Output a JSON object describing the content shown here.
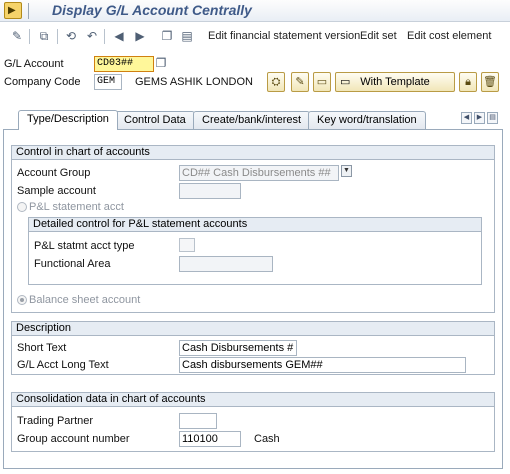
{
  "window": {
    "title": "Display G/L Account Centrally"
  },
  "toolbar": {
    "icons": [
      "display-change-icon",
      "where-used-icon",
      "other-object-icon",
      "undo-icon",
      "previous-icon",
      "next-icon",
      "copy-icon",
      "print-icon"
    ],
    "edit_fs_version": "Edit financial statement version",
    "edit_set": "Edit set",
    "edit_cost_element": "Edit cost element"
  },
  "header": {
    "gl_account_label": "G/L Account",
    "gl_account_value": "CD03##",
    "company_code_label": "Company Code",
    "company_code_value": "GEM",
    "company_name": "GEMS ASHIK LONDON",
    "with_template": "With Template"
  },
  "tabs": [
    {
      "label": "Type/Description",
      "active": true
    },
    {
      "label": "Control Data",
      "active": false
    },
    {
      "label": "Create/bank/interest",
      "active": false
    },
    {
      "label": "Key word/translation",
      "active": false
    }
  ],
  "control_chart": {
    "title": "Control in chart of accounts",
    "account_group_label": "Account Group",
    "account_group_value": "CD## Cash Disbursements ##",
    "sample_account_label": "Sample account",
    "sample_account_value": "",
    "pl_statement_label": "P&L statement acct",
    "pl_statement_selected": false,
    "detailed_title": "Detailed control for P&L statement accounts",
    "pl_type_label": "P&L statmt acct type",
    "functional_area_label": "Functional Area",
    "balance_sheet_label": "Balance sheet account",
    "balance_sheet_selected": true
  },
  "description": {
    "title": "Description",
    "short_text_label": "Short Text",
    "short_text_value": "Cash Disbursements #",
    "long_text_label": "G/L Acct Long Text",
    "long_text_value": "Cash disbursements GEM##"
  },
  "consolidation": {
    "title": "Consolidation data in chart of accounts",
    "trading_partner_label": "Trading Partner",
    "trading_partner_value": "",
    "group_account_label": "Group account number",
    "group_account_value": "110100",
    "group_account_text": "Cash"
  },
  "colors": {
    "title": "#3f5a88",
    "group_header_bg": "#e6ecf3",
    "highlight_field": "#fff79a"
  }
}
